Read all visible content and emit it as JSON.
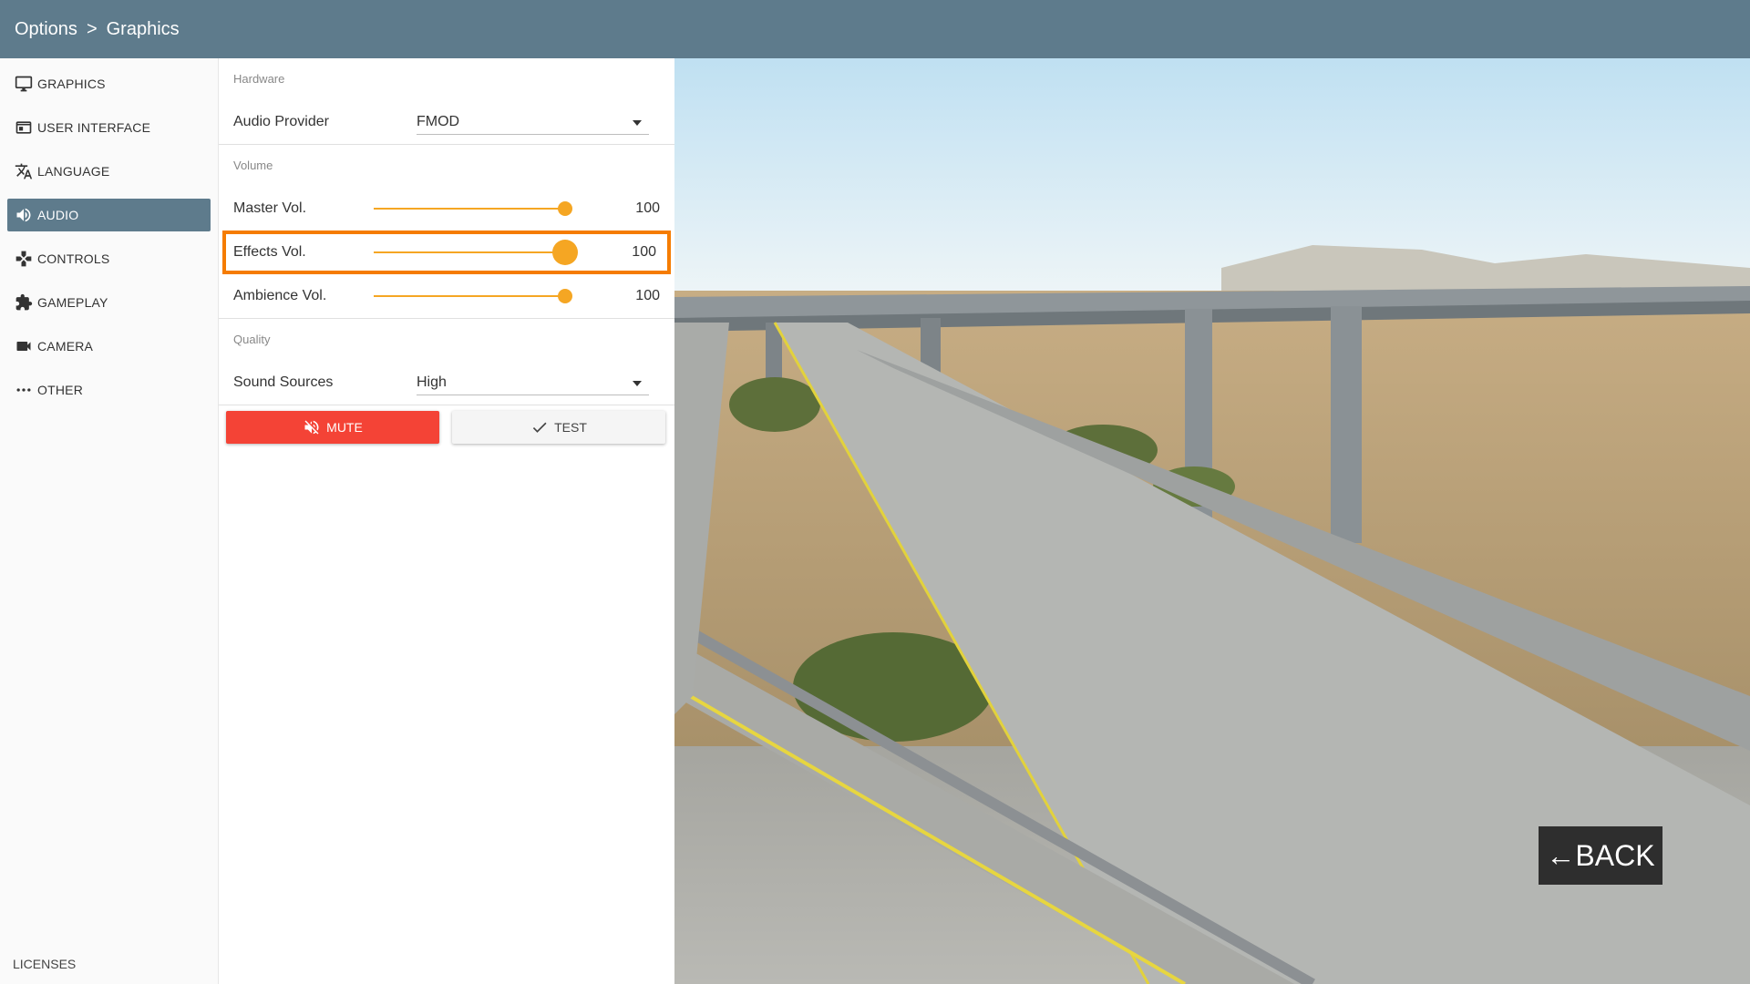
{
  "header": {
    "breadcrumb": [
      "Options",
      "Graphics"
    ],
    "separator": ">"
  },
  "sidebar": {
    "items": [
      {
        "label": "GRAPHICS",
        "icon": "monitor-icon",
        "active": false
      },
      {
        "label": "USER INTERFACE",
        "icon": "window-icon",
        "active": false
      },
      {
        "label": "LANGUAGE",
        "icon": "translate-icon",
        "active": false
      },
      {
        "label": "AUDIO",
        "icon": "speaker-icon",
        "active": true
      },
      {
        "label": "CONTROLS",
        "icon": "gamepad-icon",
        "active": false
      },
      {
        "label": "GAMEPLAY",
        "icon": "puzzle-icon",
        "active": false
      },
      {
        "label": "CAMERA",
        "icon": "video-camera-icon",
        "active": false
      },
      {
        "label": "OTHER",
        "icon": "more-dots-icon",
        "active": false
      }
    ],
    "footer": "LICENSES"
  },
  "panel": {
    "hardware": {
      "section": "Hardware",
      "audio_provider_label": "Audio Provider",
      "audio_provider_value": "FMOD"
    },
    "volume": {
      "section": "Volume",
      "master": {
        "label": "Master Vol.",
        "value": "100",
        "level": 1.0
      },
      "effects": {
        "label": "Effects Vol.",
        "value": "100",
        "level": 1.0
      },
      "ambience": {
        "label": "Ambience Vol.",
        "value": "100",
        "level": 1.0
      }
    },
    "quality": {
      "section": "Quality",
      "sound_sources_label": "Sound Sources",
      "sound_sources_value": "High"
    },
    "buttons": {
      "mute": "MUTE",
      "test": "TEST"
    }
  },
  "back_button": "BACK",
  "colors": {
    "header": "#5e7b8c",
    "accent": "#f5a623",
    "focus": "#f57c00",
    "mute": "#f44336"
  }
}
